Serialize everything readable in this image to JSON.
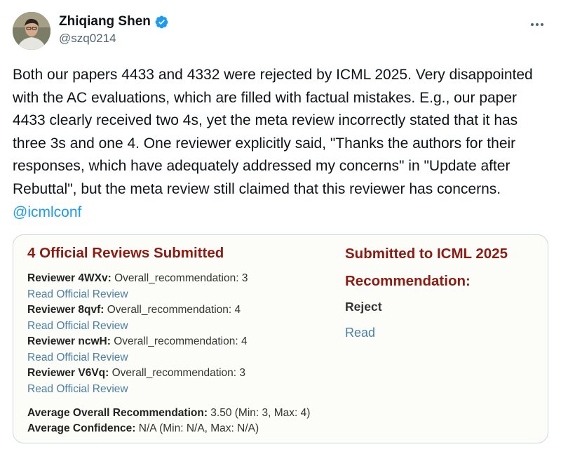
{
  "author": {
    "name": "Zhiqiang Shen",
    "handle": "@szq0214"
  },
  "tweet": {
    "text": "Both our papers 4433 and 4332 were rejected by ICML 2025. Very disappointed with the AC evaluations, which are filled with factual mistakes. E.g., our paper 4433 clearly received two 4s, yet the meta review incorrectly stated that it has three 3s and one 4. One reviewer explicitly said, \"Thanks the authors for their responses, which have adequately addressed my concerns\" in \"Update after Rebuttal\", but the meta review still claimed that this reviewer has concerns.",
    "mention": "@icmlconf"
  },
  "card": {
    "title": "4 Official Reviews Submitted",
    "reviews": [
      {
        "reviewer": "Reviewer 4WXv:",
        "detail": "Overall_recommendation: 3",
        "link": "Read Official Review"
      },
      {
        "reviewer": "Reviewer 8qvf:",
        "detail": "Overall_recommendation: 4",
        "link": "Read Official Review"
      },
      {
        "reviewer": "Reviewer ncwH:",
        "detail": "Overall_recommendation: 4",
        "link": "Read Official Review"
      },
      {
        "reviewer": "Reviewer V6Vq:",
        "detail": "Overall_recommendation: 3",
        "link": "Read Official Review"
      }
    ],
    "average_recommendation_label": "Average Overall Recommendation:",
    "average_recommendation_value": "3.50 (Min: 3, Max: 4)",
    "average_confidence_label": "Average Confidence:",
    "average_confidence_value": "N/A (Min: N/A, Max: N/A)",
    "submitted_to": "Submitted to ICML 2025",
    "recommendation_label": "Recommendation:",
    "decision": "Reject",
    "read_label": "Read"
  },
  "colors": {
    "verified": "#1d9bf0",
    "mention": "#1d9bf0",
    "card_title": "#8c1b13",
    "card_link": "#4c80a6"
  },
  "icons": {
    "verified": "verified-badge-icon",
    "more": "more-horizontal-icon"
  }
}
